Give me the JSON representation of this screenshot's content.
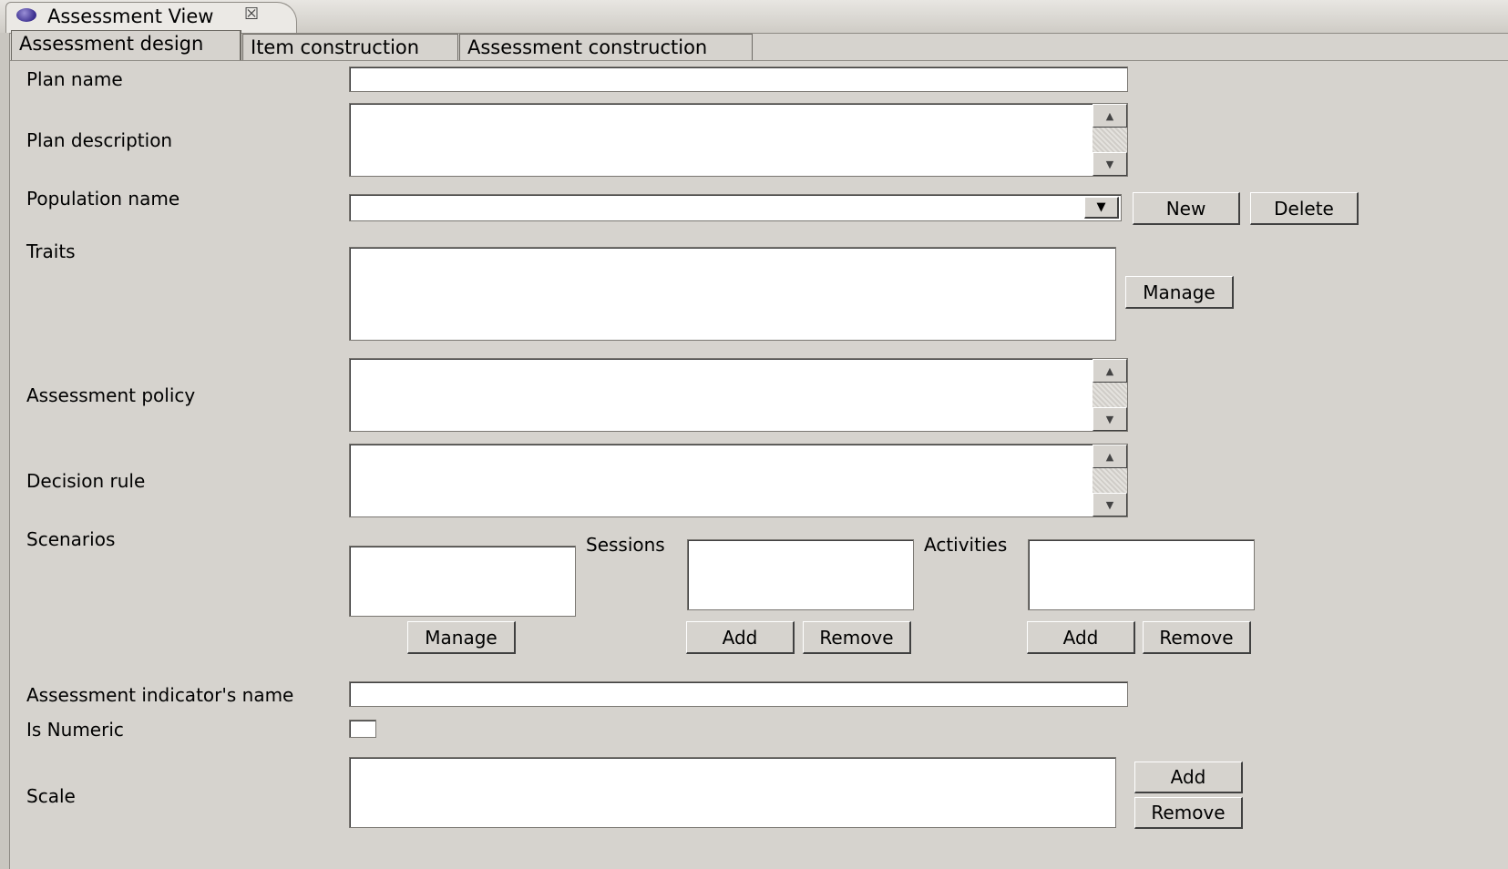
{
  "view": {
    "title": "Assessment View",
    "close_icon": "☒"
  },
  "tabs": [
    {
      "label": "Assessment design",
      "selected": true
    },
    {
      "label": "Item construction",
      "selected": false
    },
    {
      "label": "Assessment construction",
      "selected": false
    }
  ],
  "form": {
    "plan_name_label": "Plan name",
    "plan_name_value": "",
    "plan_description_label": "Plan description",
    "population_name_label": "Population name",
    "population_selected": "",
    "new_label": "New",
    "delete_label": "Delete",
    "traits_label": "Traits",
    "traits_manage_label": "Manage",
    "assessment_policy_label": "Assessment policy",
    "decision_rule_label": "Decision rule",
    "scenarios_label": "Scenarios",
    "scenarios_manage_label": "Manage",
    "sessions_label": "Sessions",
    "sessions_add_label": "Add",
    "sessions_remove_label": "Remove",
    "activities_label": "Activities",
    "activities_add_label": "Add",
    "activities_remove_label": "Remove",
    "indicator_name_label": "Assessment indicator's name",
    "indicator_name_value": "",
    "is_numeric_label": "Is Numeric",
    "is_numeric_checked": false,
    "scale_label": "Scale",
    "scale_add_label": "Add",
    "scale_remove_label": "Remove"
  },
  "icons": {
    "scroll_up": "▲",
    "scroll_down": "▼",
    "dropdown": "▼"
  }
}
